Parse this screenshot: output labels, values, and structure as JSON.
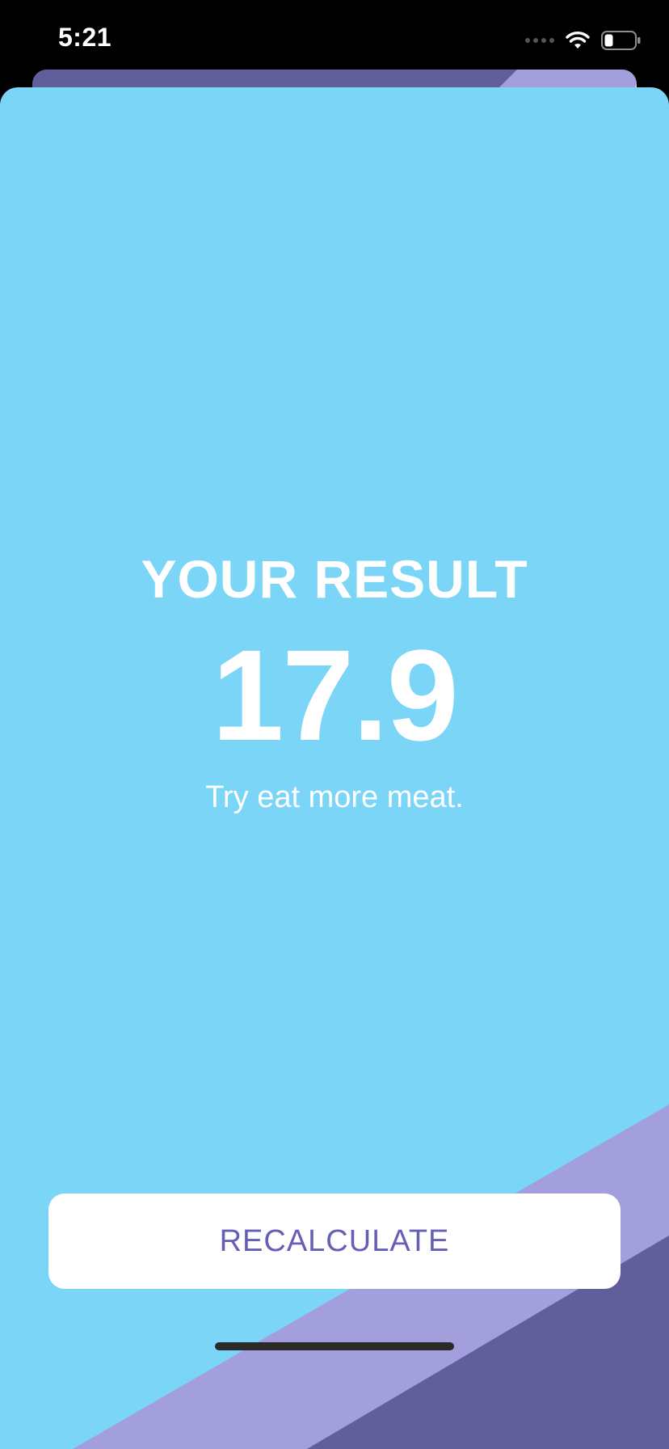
{
  "status_bar": {
    "time": "5:21",
    "icons": [
      "cellular-signal-icon",
      "wifi-icon",
      "battery-icon"
    ]
  },
  "result": {
    "title": "YOUR RESULT",
    "value": "17.9",
    "advice": "Try eat more meat."
  },
  "actions": {
    "recalculate_label": "RECALCULATE"
  },
  "colors": {
    "background": "#7bd5f7",
    "accent_dark": "#615f9b",
    "accent_light": "#a29fdc",
    "text": "#ffffff",
    "button_text": "#6560b6",
    "button_bg": "#ffffff"
  }
}
